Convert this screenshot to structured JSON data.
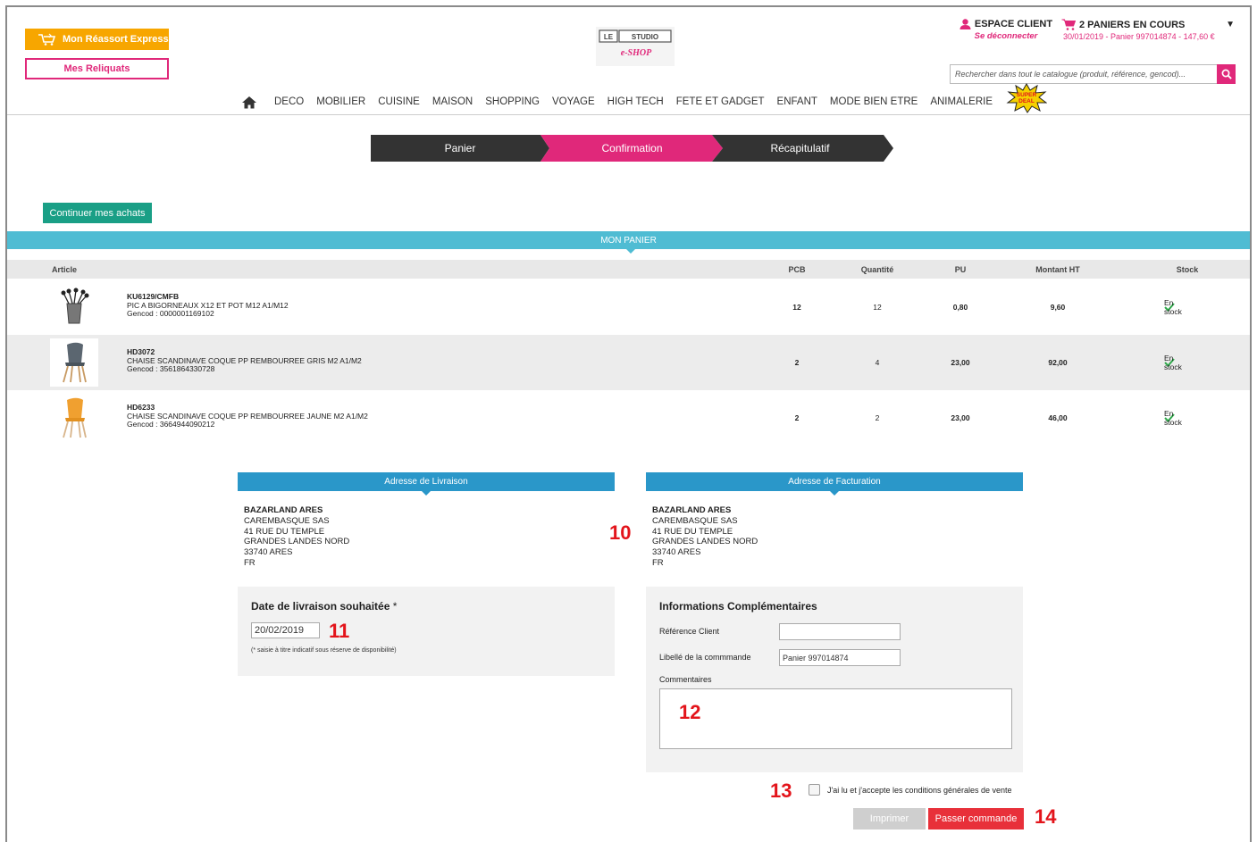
{
  "header": {
    "express_label": "Mon Réassort Express",
    "reliquats_label": "Mes Reliquats",
    "logo_text_top": "LE STUDIO",
    "logo_text_bottom": "e-SHOP",
    "client_title": "ESPACE CLIENT",
    "client_logout": "Se déconnecter",
    "cart_title": "2 PANIERS EN COURS",
    "cart_sub": "30/01/2019 - Panier 997014874 - 147,60 €",
    "search_placeholder": "Rechercher dans tout le catalogue (produit, référence, gencod)...",
    "badge_text": "SUPER DEAL"
  },
  "nav": {
    "items": [
      "DECO",
      "MOBILIER",
      "CUISINE",
      "MAISON",
      "SHOPPING",
      "VOYAGE",
      "HIGH TECH",
      "FETE ET GADGET",
      "ENFANT",
      "MODE BIEN ETRE",
      "ANIMALERIE"
    ]
  },
  "steps": [
    "Panier",
    "Confirmation",
    "Récapitulatif"
  ],
  "continue_label": "Continuer mes achats",
  "panier": {
    "title": "MON PANIER",
    "columns": {
      "article": "Article",
      "pcb": "PCB",
      "quantite": "Quantité",
      "pu": "PU",
      "montant": "Montant HT",
      "stock": "Stock"
    },
    "rows": [
      {
        "ref": "KU6129/CMFB",
        "name": "PIC A BIGORNEAUX X12 ET POT M12 A1/M12",
        "gencod": "Gencod : 0000001169102",
        "pcb": "12",
        "qty": "12",
        "pu": "0,80",
        "montant": "9,60",
        "stock": "En stock"
      },
      {
        "ref": "HD3072",
        "name": "CHAISE SCANDINAVE COQUE PP REMBOURREE GRIS M2 A1/M2",
        "gencod": "Gencod : 3561864330728",
        "pcb": "2",
        "qty": "4",
        "pu": "23,00",
        "montant": "92,00",
        "stock": "En stock"
      },
      {
        "ref": "HD6233",
        "name": "CHAISE SCANDINAVE COQUE PP REMBOURREE JAUNE M2 A1/M2",
        "gencod": "Gencod : 3664944090212",
        "pcb": "2",
        "qty": "2",
        "pu": "23,00",
        "montant": "46,00",
        "stock": "En stock"
      }
    ]
  },
  "livraison": {
    "title": "Adresse de Livraison",
    "lines": [
      "BAZARLAND ARES",
      "CAREMBASQUE SAS",
      "41 RUE DU TEMPLE",
      "GRANDES LANDES NORD",
      "33740 ARES",
      "FR"
    ]
  },
  "facturation": {
    "title": "Adresse de Facturation",
    "lines": [
      "BAZARLAND ARES",
      "CAREMBASQUE SAS",
      "41 RUE DU TEMPLE",
      "GRANDES LANDES NORD",
      "33740 ARES",
      "FR"
    ]
  },
  "date": {
    "title": "Date de livraison souhaitée",
    "required": "*",
    "value": "20/02/2019",
    "note": "(* saisie à titre indicatif sous réserve de disponibilité)"
  },
  "info": {
    "title": "Informations Complémentaires",
    "ref_label": "Référence Client",
    "ref_value": "",
    "libelle_label": "Libellé de la commmande",
    "libelle_value": "Panier 997014874",
    "comments_label": "Commentaires"
  },
  "cgv_label": "J'ai lu et j'accepte les conditions générales de vente",
  "print_label": "Imprimer",
  "order_label": "Passer commande",
  "annotations": [
    "10",
    "11",
    "12",
    "13",
    "14"
  ],
  "colors": {
    "pink": "#e0287a",
    "orange": "#f7a600",
    "teal": "#1a9f86",
    "cyan": "#4fbcd3",
    "blue": "#2a97c9",
    "red": "#e8303a",
    "dark": "#333333"
  }
}
